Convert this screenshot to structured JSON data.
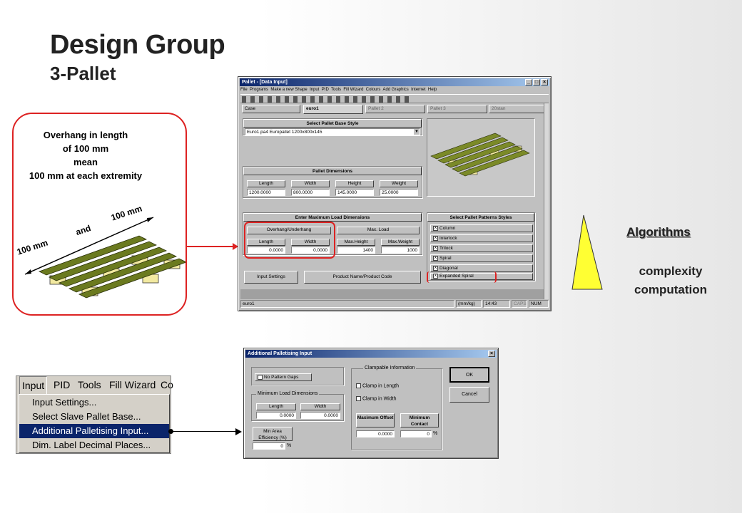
{
  "slide": {
    "title": "Design Group",
    "subtitle": "3-Pallet",
    "accent_red": "#dd2222"
  },
  "callout": {
    "line1": "Overhang in length",
    "line2": "of 100 mm",
    "line3": "mean",
    "line4": "100 mm at each extremity",
    "dim_right": "100 mm",
    "dim_and": "and",
    "dim_left": "100 mm"
  },
  "main_window": {
    "title": "Pallet - [Data Input]",
    "menu": [
      "File",
      "Programs",
      "Make a new Shape",
      "Input",
      "PID",
      "Tools",
      "Fill Wizard",
      "Colours",
      "Add Graphics",
      "Internet",
      "Help"
    ],
    "tabs": [
      "Case",
      "euro1",
      "Pallet 2",
      "Pallet 3",
      "20stan"
    ],
    "base_style_title": "Select Pallet Base Style",
    "base_style_value": "Euro1.pa4          Europallet 1200x800x145",
    "dims_title": "Pallet Dimensions",
    "dims_headers": [
      "Length",
      "Width",
      "Height",
      "Weight"
    ],
    "dims_values": [
      "1200.0000",
      "800.0000",
      "145.0000",
      "25.0000"
    ],
    "load_title": "Enter Maximum Load Dimensions",
    "overhang_title": "Overhang/Underhang",
    "max_load_title": "Max. Load",
    "load_headers": [
      "Length",
      "Width",
      "Max.Height",
      "Max.Weight"
    ],
    "load_values": [
      "0.0000",
      "0.0000",
      "1400",
      "1000"
    ],
    "patterns_title": "Select Pallet Patterns Styles",
    "patterns": [
      "Column",
      "Interlock",
      "Trilock",
      "Spiral",
      "Diagonal",
      "Expanded Spiral"
    ],
    "input_settings": "Input Settings",
    "product_name": "Product Name/Product Code",
    "status": [
      "euro1",
      "(mm/kg)",
      "14:43",
      "CAPS",
      "NUM"
    ]
  },
  "right_side": {
    "algorithms": "Algorithms",
    "complexity": "complexity",
    "computation": "computation"
  },
  "menu_crop": {
    "bar": [
      "Input",
      "PID",
      "Tools",
      "Fill Wizard",
      "Co"
    ],
    "items": [
      "Input Settings...",
      "Select Slave Pallet Base...",
      "Additional Palletising Input...",
      "Dim. Label Decimal Places..."
    ]
  },
  "dialog": {
    "title": "Additional Palletising Input",
    "no_pattern_gaps": "No Pattern Gaps",
    "min_load_title": "Minimum Load Dimensions",
    "min_headers": [
      "Length",
      "Width"
    ],
    "min_values": [
      "0.0000",
      "0.0000"
    ],
    "min_area_label": "Min Area Efficiency (%)",
    "min_area_value": "0",
    "percent": "%",
    "clamp_title": "Clampable Information",
    "clamp_length": "Clamp in Length",
    "clamp_width": "Clamp in Width",
    "max_offset_label": "Maximum Offset",
    "min_contact_label": "Minimum Contact",
    "max_offset_value": "0.0000",
    "min_contact_value": "0",
    "ok": "OK",
    "cancel": "Cancel"
  }
}
